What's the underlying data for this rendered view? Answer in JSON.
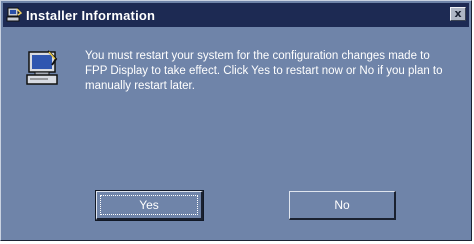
{
  "window": {
    "title": "Installer Information",
    "close_glyph": "x",
    "title_icon": "installer-icon"
  },
  "dialog": {
    "message": "You must restart your system for the configuration changes made to FPP Display to take effect. Click Yes to restart now or No if you plan to manually restart later.",
    "icon": "computer-setup-icon"
  },
  "buttons": {
    "yes_label": "Yes",
    "no_label": "No"
  },
  "colors": {
    "titlebar": "#1d2a53",
    "dialog_bg": "#6f84a9",
    "text": "#ffffff"
  }
}
